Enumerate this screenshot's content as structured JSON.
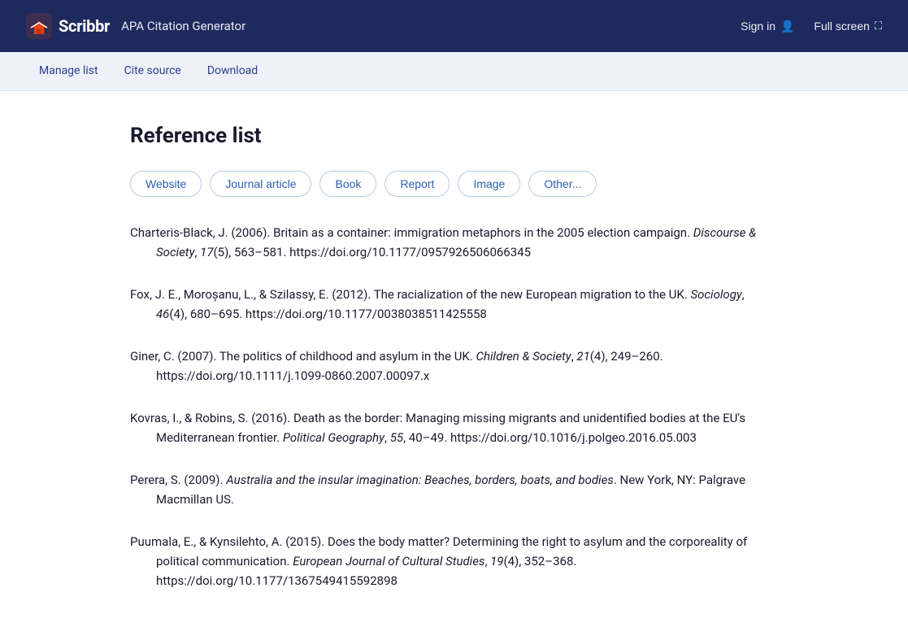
{
  "header": {
    "logo_text": "Scribbr",
    "app_title": "APA Citation Generator",
    "sign_in_label": "Sign in",
    "full_screen_label": "Full screen"
  },
  "nav": {
    "items": [
      {
        "label": "Manage list",
        "id": "manage-list"
      },
      {
        "label": "Cite source",
        "id": "cite-source"
      },
      {
        "label": "Download",
        "id": "download"
      }
    ]
  },
  "main": {
    "title": "Reference list",
    "source_types": [
      {
        "label": "Website"
      },
      {
        "label": "Journal article"
      },
      {
        "label": "Book"
      },
      {
        "label": "Report"
      },
      {
        "label": "Image"
      },
      {
        "label": "Other..."
      }
    ],
    "references": [
      {
        "id": "ref1",
        "text_html": "Charteris-Black, J. (2006). Britain as a container: immigration metaphors in the 2005 election campaign. <em>Discourse &amp; Society</em>, <em>17</em>(5), 563–581. https://doi.org/10.1177/0957926506066345"
      },
      {
        "id": "ref2",
        "text_html": "Fox, J. E., Moroșanu, L., &amp; Szilassy, E. (2012). The racialization of the new European migration to the UK. <em>Sociology</em>, <em>46</em>(4), 680–695. https://doi.org/10.1177/0038038511425558"
      },
      {
        "id": "ref3",
        "text_html": "Giner, C. (2007). The politics of childhood and asylum in the UK. <em>Children &amp; Society</em>, <em>21</em>(4), 249–260. https://doi.org/10.1111/j.1099-0860.2007.00097.x"
      },
      {
        "id": "ref4",
        "text_html": "Kovras, I., &amp; Robins, S. (2016). Death as the border: Managing missing migrants and unidentified bodies at the EU's Mediterranean frontier. <em>Political Geography</em>, <em>55</em>, 40–49. https://doi.org/10.1016/j.polgeo.2016.05.003"
      },
      {
        "id": "ref5",
        "text_html": "Perera, S. (2009). <em>Australia and the insular imagination: Beaches, borders, boats, and bodies</em>. New York, NY: Palgrave Macmillan US."
      },
      {
        "id": "ref6",
        "text_html": "Puumala, E., &amp; Kynsilehto, A. (2015). Does the body matter? Determining the right to asylum and the corporeality of political communication. <em>European Journal of Cultural Studies</em>, <em>19</em>(4), 352–368. https://doi.org/10.1177/1367549415592898"
      }
    ]
  }
}
